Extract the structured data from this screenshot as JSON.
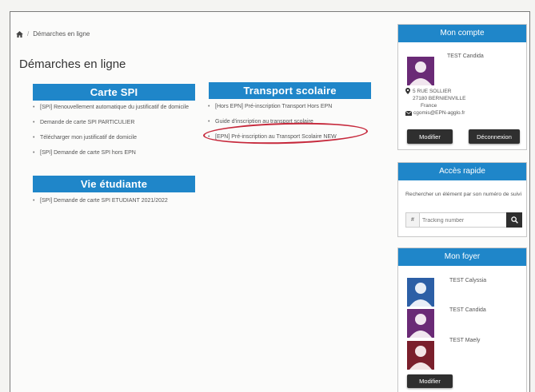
{
  "breadcrumb": {
    "current": "Démarches en ligne"
  },
  "page_title": "Démarches en ligne",
  "sections": {
    "carte_spi": {
      "title": "Carte SPI",
      "links": [
        "[SPI] Renouvellement automatique du justificatif de domicile",
        "Demande de carte SPI PARTICULIER",
        "Télécharger mon justificatif de domicile",
        "[SPI] Demande de carte SPI hors EPN"
      ]
    },
    "transport_scolaire": {
      "title": "Transport scolaire",
      "links": [
        "[Hors EPN] Pré-inscription Transport Hors EPN",
        "Guide d'inscription au transport scolaire",
        "[EPN] Pré-inscription au Transport Scolaire NEW"
      ]
    },
    "vie_etudiante": {
      "title": "Vie étudiante",
      "links": [
        "[SPI] Demande de carte SPI ETUDIANT 2021/2022"
      ]
    }
  },
  "mon_compte": {
    "title": "Mon compte",
    "name": "TEST Candida",
    "address_line1": "5 RUE SOLLIER",
    "address_line2": "27180 BERNIENVILLE",
    "country": "France",
    "email": "cgomis@EPN-agglo.fr",
    "modify_label": "Modifier",
    "logout_label": "Déconnexion"
  },
  "acces_rapide": {
    "title": "Accès rapide",
    "description": "Rechercher un élément par son numéro de suivi",
    "input_prefix": "#",
    "placeholder": "Tracking number"
  },
  "mon_foyer": {
    "title": "Mon foyer",
    "members": [
      {
        "name": "TEST Calyssia",
        "avatar_color": "#2c5fa6"
      },
      {
        "name": "TEST Candida",
        "avatar_color": "#6a2a76"
      },
      {
        "name": "TEST Maely",
        "avatar_color": "#7a1f2c"
      }
    ],
    "modify_label": "Modifier"
  },
  "colors": {
    "accent_blue": "#1f86c9",
    "highlight_red": "#c6283b",
    "button_dark": "#2f2f2f"
  }
}
